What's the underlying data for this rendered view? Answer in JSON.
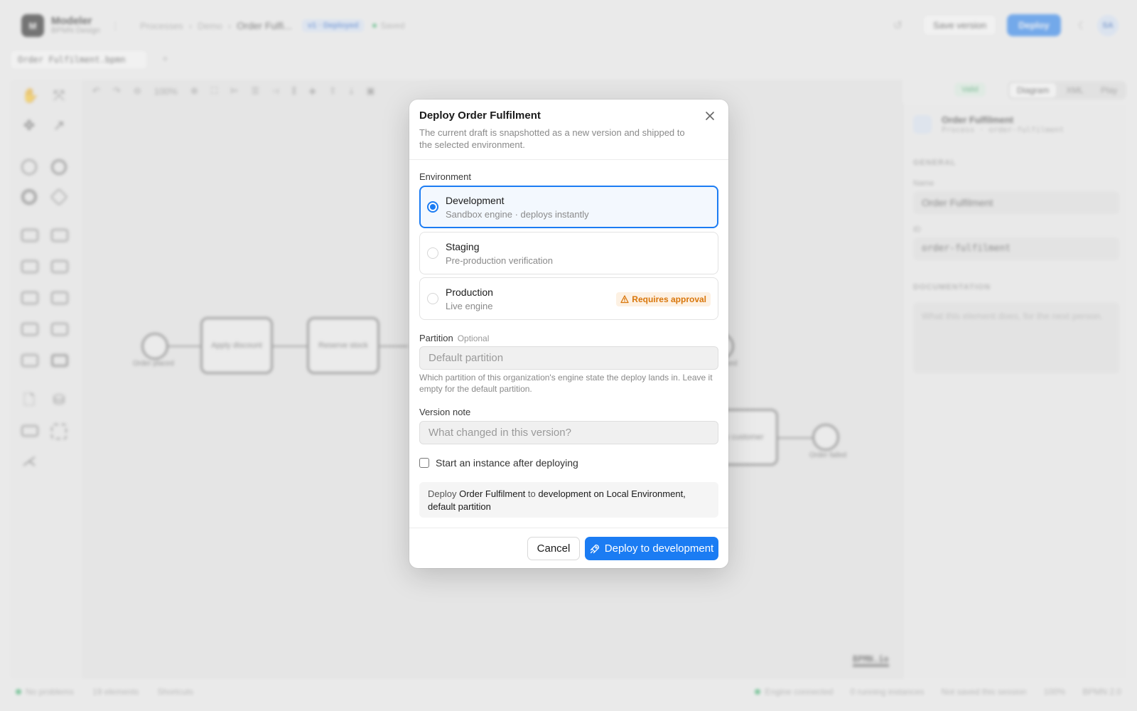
{
  "app": {
    "name": "Modeler",
    "subtitle": "BPMN Design",
    "logo_letter": "M",
    "breadcrumbs": [
      "Processes",
      "Demo",
      "Order Fulfi..."
    ],
    "version_badge": "v1 · Deployed",
    "saved_text": "Saved",
    "save_version_label": "Save version",
    "deploy_label": "Deploy",
    "avatar_initials": "SA"
  },
  "file_tab": {
    "name": "Order Fulfilment.bpmn"
  },
  "canvas_toolbar": {
    "zoom": "100%",
    "valid_label": "Valid",
    "view_tabs": [
      "Diagram",
      "XML",
      "Play"
    ]
  },
  "diagram": {
    "start_label": "Order placed",
    "task1": "Apply discount",
    "task2": "Reserve stock",
    "task3_partial": "ify customer",
    "end_label": "Order failed",
    "end2_partial": "ipped",
    "bpmn_mark": "BPMN.io"
  },
  "properties": {
    "title": "Order Fulfilment",
    "subtitle": "Process · order-fulfilment",
    "general_section": "GENERAL",
    "name_label": "Name",
    "name_value": "Order Fulfilment",
    "id_label": "ID",
    "id_value": "order-fulfilment",
    "documentation_section": "DOCUMENTATION",
    "documentation_placeholder": "What this element does, for the next person."
  },
  "status": {
    "problems": "No problems",
    "elements": "19 elements",
    "shortcuts": "Shortcuts",
    "engine": "Engine connected",
    "instances": "0 running instances",
    "session": "Not saved this session",
    "zoom": "100%",
    "standard": "BPMN 2.0"
  },
  "modal": {
    "title": "Deploy Order Fulfilment",
    "description": "The current draft is snapshotted as a new version and shipped to the selected environment.",
    "environment_label": "Environment",
    "environments": [
      {
        "name": "Development",
        "sub": "Sandbox engine · deploys instantly",
        "selected": true
      },
      {
        "name": "Staging",
        "sub": "Pre-production verification",
        "selected": false
      },
      {
        "name": "Production",
        "sub": "Live engine",
        "selected": false,
        "badge": "Requires approval"
      }
    ],
    "partition_label": "Partition",
    "partition_optional": "Optional",
    "partition_placeholder": "Default partition",
    "partition_help": "Which partition of this organization's engine state the deploy lands in. Leave it empty for the default partition.",
    "version_note_label": "Version note",
    "version_note_placeholder": "What changed in this version?",
    "start_instance_label": "Start an instance after deploying",
    "start_instance_checked": false,
    "summary": {
      "prefix": "Deploy",
      "process": "Order Fulfilment",
      "to": "to",
      "target": "development on Local Environment,",
      "partition": "default partition"
    },
    "cancel_label": "Cancel",
    "deploy_button_label": "Deploy to development"
  },
  "colors": {
    "accent": "#1b7cf3",
    "warning": "#d9760a",
    "success": "#38b26c"
  }
}
